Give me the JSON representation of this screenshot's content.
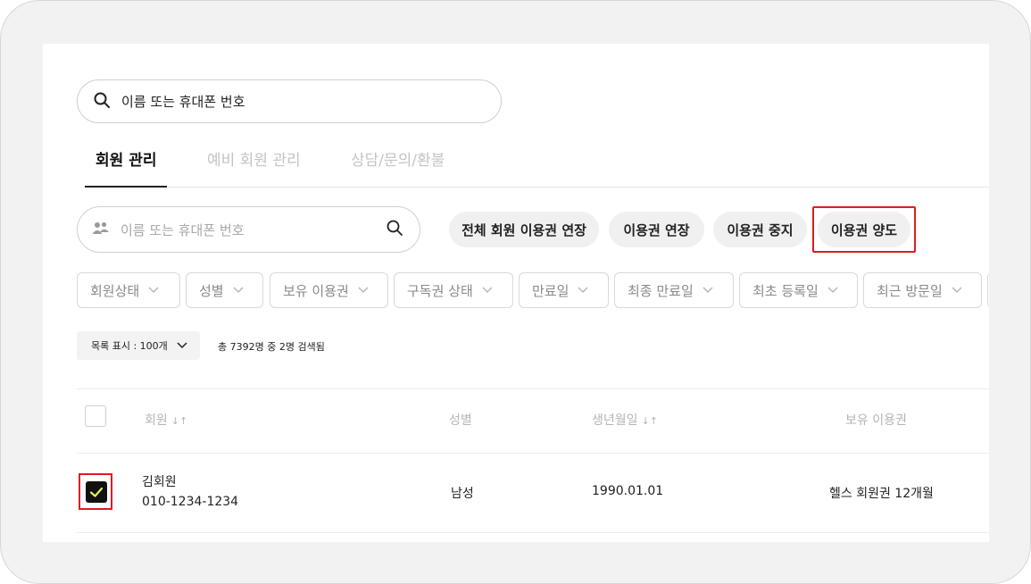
{
  "top_search": {
    "placeholder": "이름 또는 휴대폰 번호",
    "icon": "search-icon"
  },
  "tabs": [
    {
      "label": "회원 관리",
      "active": true
    },
    {
      "label": "예비 회원 관리",
      "active": false
    },
    {
      "label": "상담/문의/환불",
      "active": false
    }
  ],
  "member_search": {
    "placeholder": "이름 또는 휴대폰 번호",
    "icon": "people-icon",
    "search_icon": "search-icon"
  },
  "actions": [
    {
      "label": "전체 회원 이용권 연장"
    },
    {
      "label": "이용권 연장"
    },
    {
      "label": "이용권 중지"
    },
    {
      "label": "이용권 양도",
      "highlighted": true
    }
  ],
  "filters": [
    {
      "label": "회원상태"
    },
    {
      "label": "성별"
    },
    {
      "label": "보유 이용권"
    },
    {
      "label": "구독권 상태"
    },
    {
      "label": "만료일"
    },
    {
      "label": "최종 만료일"
    },
    {
      "label": "최초 등록일"
    },
    {
      "label": "최근 방문일"
    }
  ],
  "list": {
    "page_size_label": "목록 표시 : 100개",
    "count_text": "총 7392명 중 2명 검색됨"
  },
  "table": {
    "headers": {
      "member": "회원",
      "gender": "성별",
      "birth": "생년월일",
      "pass": "보유 이용권",
      "sort_icon": "↓↑"
    },
    "rows": [
      {
        "checked": true,
        "name": "김회원",
        "phone": "010-1234-1234",
        "gender": "남성",
        "birth": "1990.01.01",
        "pass": "헬스 회원권 12개월"
      }
    ]
  },
  "colors": {
    "highlight": "#e01b22",
    "check_mark": "#e6f05a",
    "pill_bg": "#f0f0f0"
  }
}
